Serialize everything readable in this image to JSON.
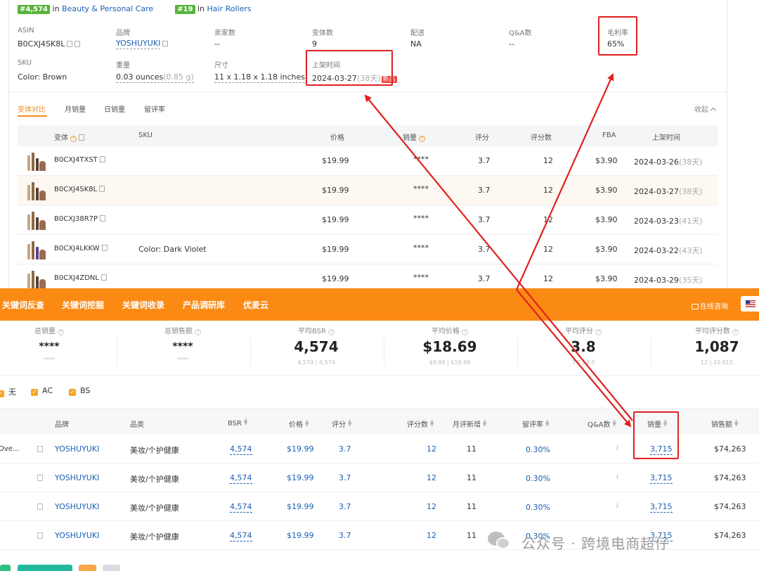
{
  "rank": {
    "r1": "#4,574",
    "in1": "in",
    "c1": "Beauty & Personal Care",
    "r2": "#19",
    "in2": "in",
    "c2": "Hair Rollers"
  },
  "info": {
    "asin_l": "ASIN",
    "asin_v": "B0CXJ4SK8L",
    "brand_l": "品牌",
    "brand_v": "YOSHUYUKI",
    "sellers_l": "卖家数",
    "sellers_v": "--",
    "variants_l": "变体数",
    "variants_v": "9",
    "ship_l": "配送",
    "ship_v": "NA",
    "qa_l": "Q&A数",
    "qa_v": "--",
    "margin_l": "毛利率",
    "margin_v": "65%",
    "sku_l": "SKU",
    "sku_v": "Color: Brown",
    "weight_l": "重量",
    "weight_v": "0.03 ounces",
    "weight_g": "(0.85 g)",
    "size_l": "尺寸",
    "size_v": "11 x 1.18 x 1.18 inches",
    "date_l": "上架时间",
    "date_v": "2024-03-27",
    "date_days": "(38天)",
    "date_badge": "新品"
  },
  "tabs": [
    "变体对比",
    "月销量",
    "日销量",
    "留评率"
  ],
  "collapse": "收起",
  "vhead": {
    "variant": "变体",
    "sku": "SKU",
    "price": "价格",
    "sales": "销量",
    "rating": "评分",
    "reviews": "评分数",
    "fba": "FBA",
    "date": "上架时间"
  },
  "variants": [
    {
      "asin": "B0CXJ4TXST",
      "sku": "",
      "price": "$19.99",
      "sales": "****",
      "rating": "3.7",
      "reviews": "12",
      "fba": "$3.90",
      "date": "2024-03-26",
      "days": "(38天)"
    },
    {
      "asin": "B0CXJ4SK8L",
      "sku": "",
      "price": "$19.99",
      "sales": "****",
      "rating": "3.7",
      "reviews": "12",
      "fba": "$3.90",
      "date": "2024-03-27",
      "days": "(38天)"
    },
    {
      "asin": "B0CXJ38R7P",
      "sku": "",
      "price": "$19.99",
      "sales": "****",
      "rating": "3.7",
      "reviews": "12",
      "fba": "$3.90",
      "date": "2024-03-23",
      "days": "(41天)"
    },
    {
      "asin": "B0CXJ4LKKW",
      "sku": "Color: Dark Violet",
      "price": "$19.99",
      "sales": "****",
      "rating": "3.7",
      "reviews": "12",
      "fba": "$3.90",
      "date": "2024-03-22",
      "days": "(43天)"
    },
    {
      "asin": "B0CXJ4ZDNL",
      "sku": "",
      "price": "$19.99",
      "sales": "****",
      "rating": "3.7",
      "reviews": "12",
      "fba": "$3.90",
      "date": "2024-03-29",
      "days": "(35天)"
    }
  ],
  "nav": [
    "关键词反查",
    "关键词挖掘",
    "关键词收录",
    "产品调研库",
    "优麦云"
  ],
  "consult": "在线咨询",
  "stats": [
    {
      "label": "总销量",
      "value": "****",
      "sub": "****"
    },
    {
      "label": "总销售额",
      "value": "****",
      "sub": "****"
    },
    {
      "label": "平均BSR",
      "value": "4,574",
      "sub": "4,574 | 4,574"
    },
    {
      "label": "平均价格",
      "value": "$18.69",
      "sub": "$9.99 | $19.99"
    },
    {
      "label": "平均评分",
      "value": "3.8",
      "sub": "3.7 | 4.5"
    },
    {
      "label": "平均评分数",
      "value": "1,087",
      "sub": "12 | 10,615"
    }
  ],
  "filters": [
    "无",
    "AC",
    "BS"
  ],
  "bhead": {
    "brand": "品牌",
    "cat": "品类",
    "bsr": "BSR",
    "price": "价格",
    "rating": "评分",
    "reviews": "评分数",
    "monthly_new": "月评新增",
    "review_rate": "留评率",
    "qa": "Q&A数",
    "sales": "销量",
    "revenue": "销售额"
  },
  "brows": [
    {
      "title": "Ove...",
      "brand": "YOSHUYUKI",
      "cat": "美妆/个护健康",
      "bsr": "4,574",
      "price": "$19.99",
      "rating": "3.7",
      "reviews": "12",
      "monthly_new": "11",
      "review_rate": "0.30%",
      "qa": "i",
      "sales": "3,715",
      "revenue": "$74,263"
    },
    {
      "title": "",
      "brand": "YOSHUYUKI",
      "cat": "美妆/个护健康",
      "bsr": "4,574",
      "price": "$19.99",
      "rating": "3.7",
      "reviews": "12",
      "monthly_new": "11",
      "review_rate": "0.30%",
      "qa": "i",
      "sales": "3,715",
      "revenue": "$74,263"
    },
    {
      "title": "",
      "brand": "YOSHUYUKI",
      "cat": "美妆/个护健康",
      "bsr": "4,574",
      "price": "$19.99",
      "rating": "3.7",
      "reviews": "12",
      "monthly_new": "11",
      "review_rate": "0.30%",
      "qa": "i",
      "sales": "3,715",
      "revenue": "$74,263"
    },
    {
      "title": "",
      "brand": "YOSHUYUKI",
      "cat": "美妆/个护健康",
      "bsr": "4,574",
      "price": "$19.99",
      "rating": "3.7",
      "reviews": "12",
      "monthly_new": "11",
      "review_rate": "0.30%",
      "qa": "",
      "sales": "3,715",
      "revenue": "$74,263"
    }
  ],
  "watermark": "公众号 · 跨境电商超仔",
  "colors": {
    "accent": "#fb8a14",
    "link": "#1a5fb4",
    "badge": "#58b33b",
    "annotation": "#e02020"
  }
}
